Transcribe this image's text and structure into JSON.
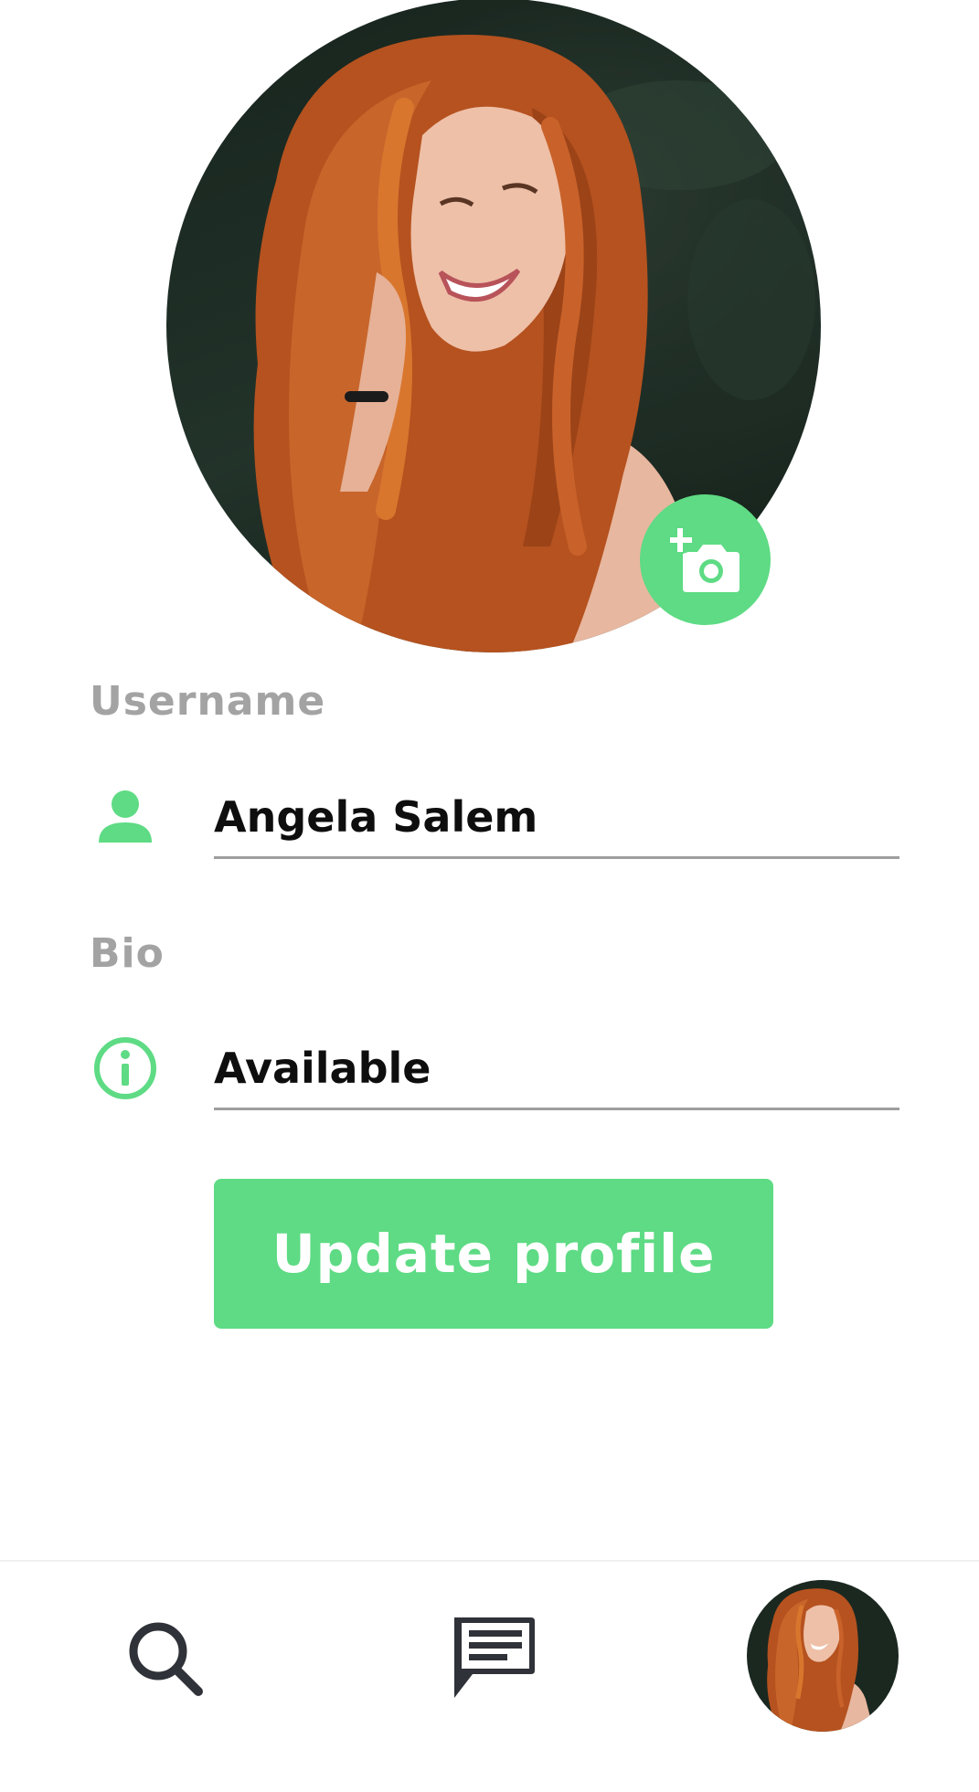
{
  "profile": {
    "photo_icon": "profile-photo",
    "change_photo_icon": "add-a-photo-icon"
  },
  "form": {
    "username_label": "Username",
    "username_value": "Angela Salem",
    "username_icon": "person-icon",
    "bio_label": "Bio",
    "bio_value": "Available",
    "bio_icon": "info-icon",
    "submit_label": "Update profile"
  },
  "nav": {
    "items": [
      {
        "icon": "search-icon"
      },
      {
        "icon": "chat-icon"
      },
      {
        "icon": "profile-avatar"
      }
    ]
  },
  "colors": {
    "accent": "#5edb84",
    "label": "#a3a3a3",
    "text": "#0e0e0e",
    "divider": "#9e9e9e",
    "nav_icon": "#2f3238"
  }
}
